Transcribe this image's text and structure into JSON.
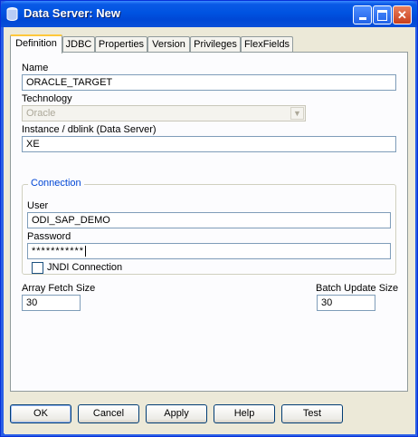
{
  "window": {
    "title": "Data Server: New"
  },
  "tabs": [
    {
      "label": "Definition"
    },
    {
      "label": "JDBC"
    },
    {
      "label": "Properties"
    },
    {
      "label": "Version"
    },
    {
      "label": "Privileges"
    },
    {
      "label": "FlexFields"
    }
  ],
  "form": {
    "name_label": "Name",
    "name_value": "ORACLE_TARGET",
    "technology_label": "Technology",
    "technology_value": "Oracle",
    "instance_label": "Instance / dblink (Data Server)",
    "instance_value": "XE",
    "connection": {
      "title": "Connection",
      "user_label": "User",
      "user_value": "ODI_SAP_DEMO",
      "password_label": "Password",
      "password_value": "***********",
      "jndi_label": "JNDI Connection",
      "jndi_checked": false
    },
    "array_fetch_label": "Array Fetch Size",
    "array_fetch_value": "30",
    "batch_update_label": "Batch Update Size",
    "batch_update_value": "30"
  },
  "buttons": {
    "ok": "OK",
    "cancel": "Cancel",
    "apply": "Apply",
    "help": "Help",
    "test": "Test"
  }
}
